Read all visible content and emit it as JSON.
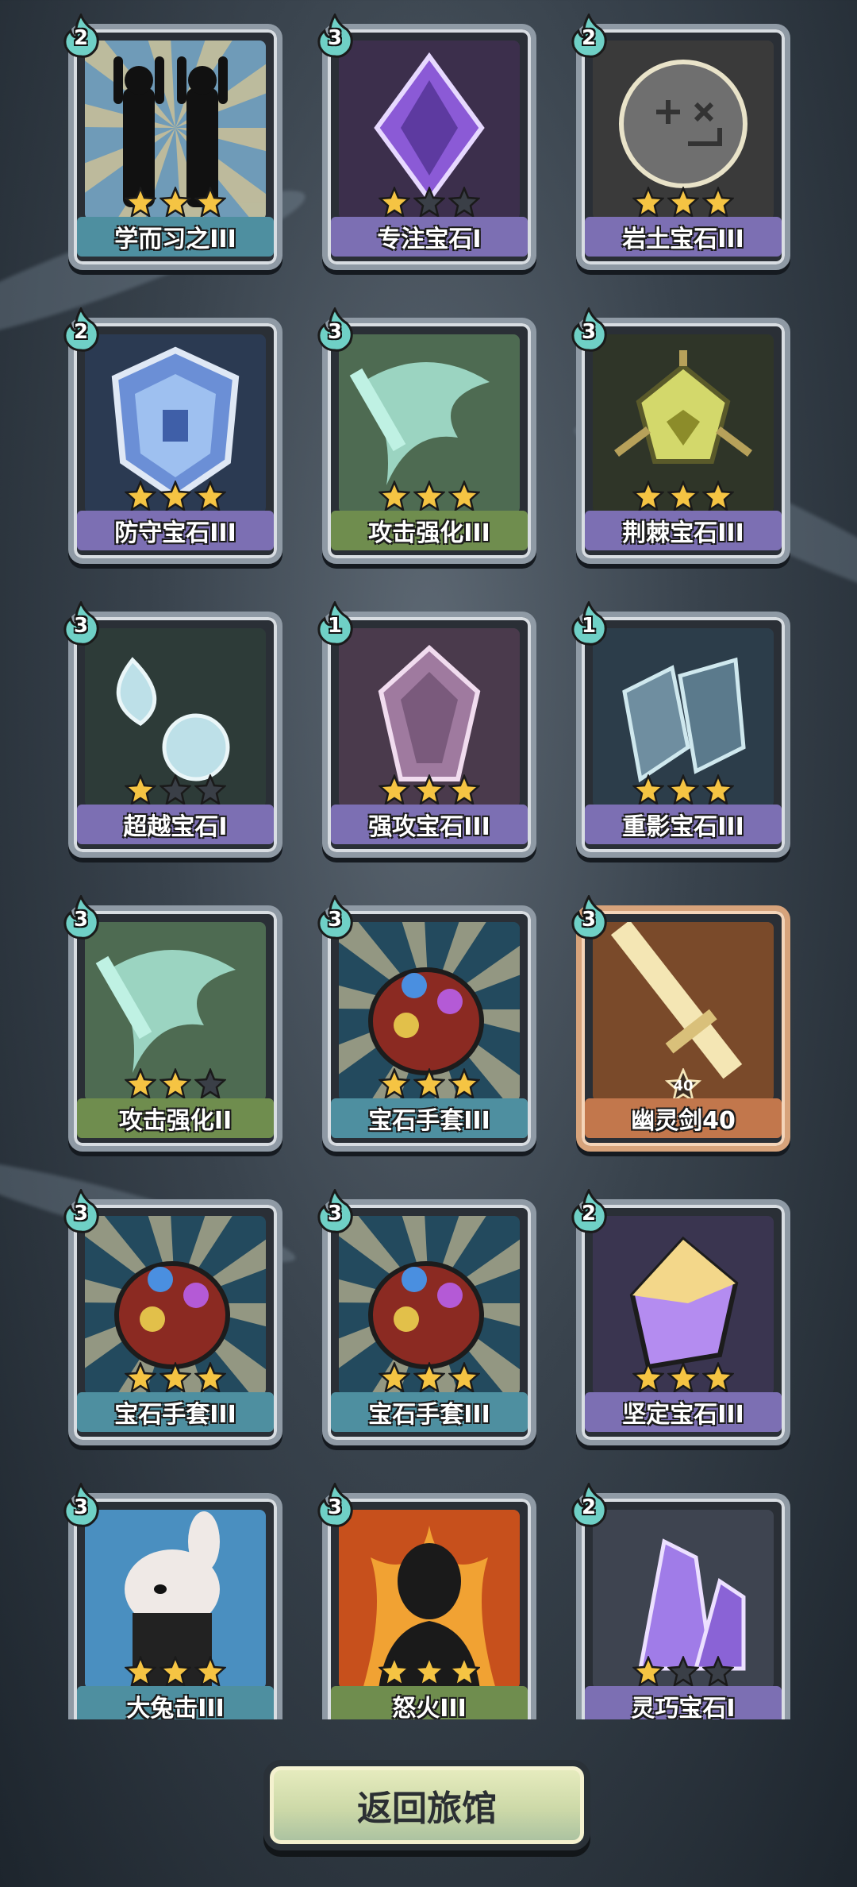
{
  "colors": {
    "star_on": "#f5c443",
    "star_off": "#3a3f47",
    "cost_flame": "#6fd0c6"
  },
  "cards": [
    {
      "name": "学而习之III",
      "cost": "2",
      "stars": 3,
      "frame": "purple",
      "label_color": "teal",
      "art": "silhouettes"
    },
    {
      "name": "专注宝石I",
      "cost": "3",
      "stars": 1,
      "frame": "purple",
      "label_color": "purple",
      "art": "purple-gem"
    },
    {
      "name": "岩土宝石III",
      "cost": "2",
      "stars": 3,
      "frame": "purple",
      "label_color": "purple",
      "art": "stone"
    },
    {
      "name": "防守宝石III",
      "cost": "2",
      "stars": 3,
      "frame": "purple",
      "label_color": "purple",
      "art": "shield-gem"
    },
    {
      "name": "攻击强化III",
      "cost": "3",
      "stars": 3,
      "frame": "green",
      "label_color": "green",
      "art": "sword-swirl"
    },
    {
      "name": "荆棘宝石III",
      "cost": "3",
      "stars": 3,
      "frame": "purple",
      "label_color": "purple",
      "art": "thorn-gem"
    },
    {
      "name": "超越宝石I",
      "cost": "3",
      "stars": 1,
      "frame": "purple",
      "label_color": "purple",
      "art": "twin-gems"
    },
    {
      "name": "强攻宝石III",
      "cost": "1",
      "stars": 3,
      "frame": "purple",
      "label_color": "purple",
      "art": "shard-gem"
    },
    {
      "name": "重影宝石III",
      "cost": "1",
      "stars": 3,
      "frame": "purple",
      "label_color": "purple",
      "art": "double-shadow"
    },
    {
      "name": "攻击强化II",
      "cost": "3",
      "stars": 2,
      "frame": "green",
      "label_color": "green",
      "art": "sword-swirl"
    },
    {
      "name": "宝石手套III",
      "cost": "3",
      "stars": 3,
      "frame": "teal",
      "label_color": "teal",
      "art": "gauntlet"
    },
    {
      "name": "幽灵剑40",
      "cost": "3",
      "stars": 0,
      "level": "40",
      "frame": "orange",
      "label_color": "orange",
      "art": "ghost-sword"
    },
    {
      "name": "宝石手套III",
      "cost": "3",
      "stars": 3,
      "frame": "teal",
      "label_color": "teal",
      "art": "gauntlet"
    },
    {
      "name": "宝石手套III",
      "cost": "3",
      "stars": 3,
      "frame": "teal",
      "label_color": "teal",
      "art": "gauntlet"
    },
    {
      "name": "坚定宝石III",
      "cost": "2",
      "stars": 3,
      "frame": "purple",
      "label_color": "purple",
      "art": "solid-gem"
    },
    {
      "name": "大兔击III",
      "cost": "3",
      "stars": 3,
      "frame": "teal",
      "label_color": "teal",
      "art": "rabbit"
    },
    {
      "name": "怒火III",
      "cost": "3",
      "stars": 3,
      "frame": "green",
      "label_color": "green",
      "art": "rage"
    },
    {
      "name": "灵巧宝石I",
      "cost": "2",
      "stars": 1,
      "frame": "purple",
      "label_color": "purple",
      "art": "crystal"
    }
  ],
  "footer": {
    "back_button": "返回旅馆"
  }
}
